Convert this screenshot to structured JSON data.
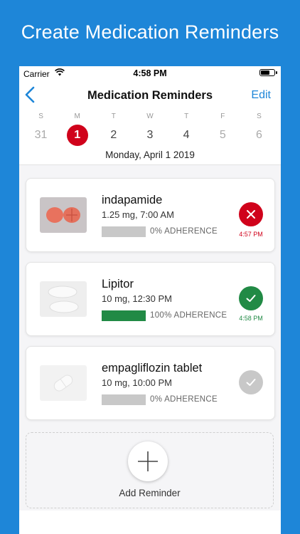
{
  "headline": "Create Medication Reminders",
  "status_bar": {
    "carrier": "Carrier",
    "time": "4:58 PM"
  },
  "nav": {
    "title": "Medication Reminders",
    "edit": "Edit"
  },
  "week": {
    "days": [
      {
        "dow": "S",
        "num": "31",
        "state": "past"
      },
      {
        "dow": "M",
        "num": "1",
        "state": "today"
      },
      {
        "dow": "T",
        "num": "2",
        "state": "normal"
      },
      {
        "dow": "W",
        "num": "3",
        "state": "normal"
      },
      {
        "dow": "T",
        "num": "4",
        "state": "normal"
      },
      {
        "dow": "F",
        "num": "5",
        "state": "weekend"
      },
      {
        "dow": "S",
        "num": "6",
        "state": "weekend"
      }
    ],
    "selected_date": "Monday, April 1 2019"
  },
  "reminders": [
    {
      "name": "indapamide",
      "dose": "1.25 mg, 7:00 AM",
      "adherence": "0% ADHERENCE",
      "adherence_fraction": 0,
      "status": "missed",
      "status_time": "4:57 PM",
      "status_color": "#d0021b",
      "thumb": "orange-pill-photo"
    },
    {
      "name": "Lipitor",
      "dose": "10 mg, 12:30 PM",
      "adherence": "100% ADHERENCE",
      "adherence_fraction": 1,
      "status": "taken",
      "status_time": "4:58 PM",
      "status_color": "#218a45",
      "thumb": "white-oval-pill-photo"
    },
    {
      "name": "empagliflozin tablet",
      "dose": "10 mg, 10:00 PM",
      "adherence": "0% ADHERENCE",
      "adherence_fraction": 0,
      "status": "pending",
      "status_time": "",
      "status_color": "#c8c8c8",
      "thumb": "capsule-placeholder"
    }
  ],
  "add_reminder": "Add Reminder",
  "colors": {
    "accent": "#1e86d8",
    "today": "#d0021b",
    "taken": "#218a45",
    "missed": "#d0021b",
    "pending": "#c8c8c8"
  }
}
